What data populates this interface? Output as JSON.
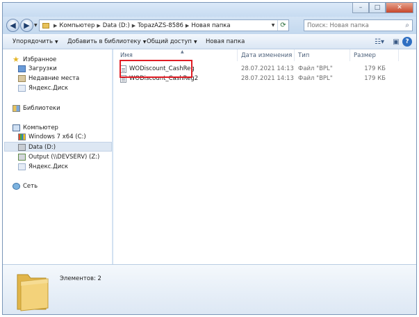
{
  "window": {
    "caption_minimize": "–",
    "caption_maximize": "□",
    "caption_close": "✕"
  },
  "address": {
    "crumbs": [
      "Компьютер",
      "Data (D:)",
      "TopazAZS-8586",
      "Новая папка"
    ],
    "search_placeholder": "Поиск: Новая папка"
  },
  "toolbar": {
    "organize": "Упорядочить",
    "add_to_library": "Добавить в библиотеку",
    "share": "Общий доступ",
    "new_folder": "Новая папка"
  },
  "nav": {
    "favorites": "Избранное",
    "downloads": "Загрузки",
    "recent": "Недавние места",
    "yandex_disk_fav": "Яндекс.Диск",
    "libraries": "Библиотеки",
    "computer": "Компьютер",
    "drive_c": "Windows 7 x64 (C:)",
    "drive_d": "Data (D:)",
    "drive_z": "Output (\\\\DEVSERV) (Z:)",
    "yandex_disk_comp": "Яндекс.Диск",
    "network": "Сеть"
  },
  "columns": {
    "name": "Имя",
    "date": "Дата изменения",
    "type": "Тип",
    "size": "Размер"
  },
  "files": [
    {
      "name": "WODiscount_CashReg",
      "date": "28.07.2021 14:13",
      "type": "Файл \"BPL\"",
      "size": "179 КБ"
    },
    {
      "name": "WODiscount_CashReg2",
      "date": "28.07.2021 14:13",
      "type": "Файл \"BPL\"",
      "size": "179 КБ"
    }
  ],
  "details": {
    "item_count": "Элементов: 2"
  },
  "colors": {
    "highlight": "#e01c24",
    "window_frame": "#c9ddf1",
    "selected_nav": "#dde7f3"
  }
}
